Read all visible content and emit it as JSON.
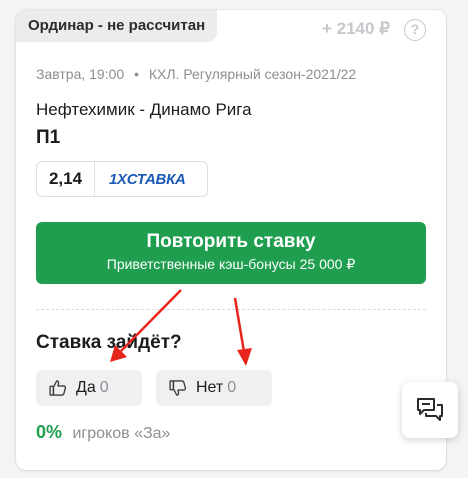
{
  "card": {
    "status_badge": "Ординар - не рассчитан",
    "payout": "+ 2140 ₽",
    "help_icon": "?",
    "date": "Завтра, 19:00",
    "separator": "•",
    "league": "КХЛ. Регулярный сезон-2021/22",
    "match": "Нефтехимик - Динамо Рига",
    "pick": "П1",
    "odds": "2,14",
    "bookmaker": "1XСТАВКА",
    "repeat_button": {
      "title": "Повторить ставку",
      "subtitle": "Приветственные кэш-бонусы 25 000 ₽"
    },
    "question": "Ставка зайдёт?",
    "vote_yes": {
      "label": "Да",
      "count": "0",
      "icon": "thumbs-up-icon"
    },
    "vote_no": {
      "label": "Нет",
      "count": "0",
      "icon": "thumbs-down-icon"
    },
    "stat": {
      "percent": "0%",
      "text": "игроков «За»"
    }
  },
  "chat_widget": {
    "icon": "chat-bubbles-icon"
  },
  "colors": {
    "accent_green": "#1f9e4f",
    "badge_bg": "#ececee",
    "annotation_red": "#e8251c",
    "bookmaker_blue": "#1a5bb8"
  }
}
